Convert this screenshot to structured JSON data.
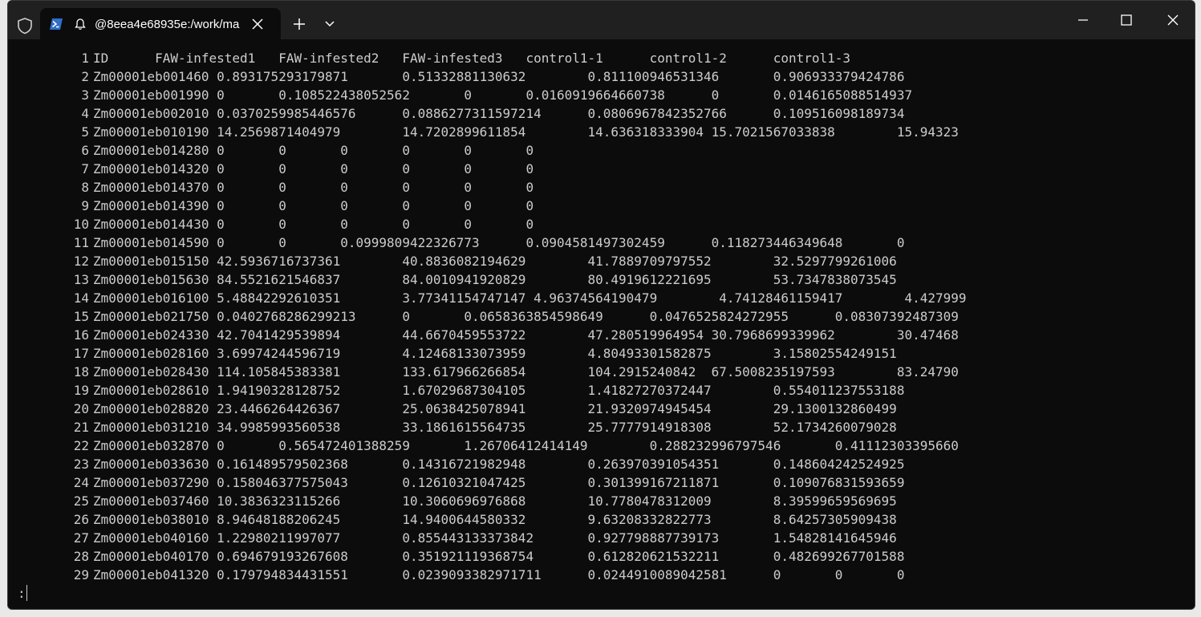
{
  "tab": {
    "title": "@8eea4e68935e:/work/ma"
  },
  "terminal": {
    "lines": [
      {
        "n": "1",
        "text": "ID      FAW-infested1   FAW-infested2   FAW-infested3   control1-1      control1-2      control1-3"
      },
      {
        "n": "2",
        "text": "Zm00001eb001460 0.893175293179871       0.51332881130632        0.811100946531346       0.906933379424786"
      },
      {
        "n": "3",
        "text": "Zm00001eb001990 0       0.108522438052562       0       0.0160919664660738      0       0.0146165088514937"
      },
      {
        "n": "4",
        "text": "Zm00001eb002010 0.0370259985446576      0.0886277311597214      0.0806967842352766      0.10951609818973​4"
      },
      {
        "n": "5",
        "text": "Zm00001eb010190 14.2569871404979        14.7202899611854        14.636318333904 15.7021567033838        15.94323"
      },
      {
        "n": "6",
        "text": "Zm00001eb014280 0       0       0       0       0       0"
      },
      {
        "n": "7",
        "text": "Zm00001eb014320 0       0       0       0       0       0"
      },
      {
        "n": "8",
        "text": "Zm00001eb014370 0       0       0       0       0       0"
      },
      {
        "n": "9",
        "text": "Zm00001eb014390 0       0       0       0       0       0"
      },
      {
        "n": "10",
        "text": "Zm00001eb014430 0       0       0       0       0       0"
      },
      {
        "n": "11",
        "text": "Zm00001eb014590 0       0       0.0999809422326773      0.0904581497302459      0.118273446349648       0"
      },
      {
        "n": "12",
        "text": "Zm00001eb015150 42.5936716737361        40.8836082194629        41.7889709797552        32.5297799261006"
      },
      {
        "n": "13",
        "text": "Zm00001eb015630 84.5521621546837        84.0010941920829        80.4919612221695        53.7347838073545"
      },
      {
        "n": "14",
        "text": "Zm00001eb016100 5.48842292610351        3.77341154747147 4.96374564190479        4.74128461159417        4.427999"
      },
      {
        "n": "15",
        "text": "Zm00001eb021750 0.0402768286299213      0       0.0658363854598649      0.0476525824272955      0.08307392487309"
      },
      {
        "n": "16",
        "text": "Zm00001eb024330 42.7041429539894        44.6670459553722        47.280519964954 30.7968699339962        30.47468"
      },
      {
        "n": "17",
        "text": "Zm00001eb028160 3.69974244596719        4.12468133073959        4.80493301582875        3.15802554249151"
      },
      {
        "n": "18",
        "text": "Zm00001eb028430 114.105845383381        133.617966266854        104.2915240842  67.5008235197593        83.24790"
      },
      {
        "n": "19",
        "text": "Zm00001eb028610 1.94190328128752        1.67029687304105        1.41827270372447        0.554011237553188"
      },
      {
        "n": "20",
        "text": "Zm00001eb028820 23.4466264426367        25.0638425078941        21.9320974945454        29.1300132860499"
      },
      {
        "n": "21",
        "text": "Zm00001eb031210 34.9985993560538        33.1861615564735        25.7777914918308        52.1734260079028"
      },
      {
        "n": "22",
        "text": "Zm00001eb032870 0       0.565472401388259       1.26706412414149        0.288232996797546       0.41112303395660"
      },
      {
        "n": "23",
        "text": "Zm00001eb033630 0.161489579502368       0.14316721982948        0.263970391054351       0.148604242524925"
      },
      {
        "n": "24",
        "text": "Zm00001eb037290 0.158046377575043       0.12610321047425        0.301399167211871       0.109076831593659"
      },
      {
        "n": "25",
        "text": "Zm00001eb037460 10.3836323115266        10.3060696976868        10.7780478312009        8.39599659569695"
      },
      {
        "n": "26",
        "text": "Zm00001eb038010 8.94648188206245        14.9400644580332        9.63208332822773        8.64257305909438"
      },
      {
        "n": "27",
        "text": "Zm00001eb040160 1.22980211997077        0.855443133373842       0.927798887739173       1.54828141645946"
      },
      {
        "n": "28",
        "text": "Zm00001eb040170 0.694679193267608       0.351921119368754       0.612820621532211       0.482699267701588"
      },
      {
        "n": "29",
        "text": "Zm00001eb041320 0.179794834431551       0.0239093382971711      0.0244910089042581      0       0       0"
      }
    ],
    "prompt": ":"
  }
}
